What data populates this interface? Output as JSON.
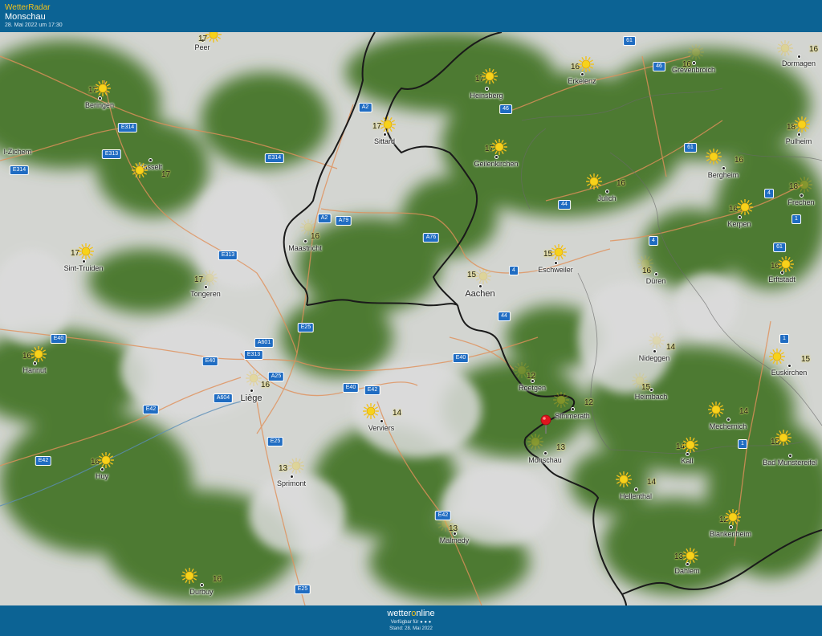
{
  "header": {
    "app_title": "WetterRadar",
    "location": "Monschau",
    "timestamp": "28. Mai 2022 um 17:30"
  },
  "footer": {
    "brand_pre": "wetter",
    "brand_o": "o",
    "brand_post": "nline",
    "availability": "Verfügbar für",
    "stand": "Stand: 28. Mai 2022"
  },
  "colors": {
    "header_bg": "#0c6394",
    "accent": "#f2c21b",
    "land_green": "#4f7a36",
    "cloud": "#d6d6d6",
    "roads": "#e0905a",
    "border": "#1a1a1a",
    "shield": "#1f6cc2"
  },
  "map": {
    "cities": [
      {
        "name": "Peer",
        "temp": "17"
      },
      {
        "name": "Beringen",
        "temp": "17"
      },
      {
        "name": "Heinsberg",
        "temp": "17"
      },
      {
        "name": "Erkelenz",
        "temp": "16"
      },
      {
        "name": "Grevenbroich",
        "temp": "16"
      },
      {
        "name": "Dormagen",
        "temp": "16"
      },
      {
        "name": "Sittard",
        "temp": "17"
      },
      {
        "name": "Pulheim",
        "temp": "18"
      },
      {
        "name": "Geilenkirchen",
        "temp": "17"
      },
      {
        "name": "Bergheim",
        "temp": "16"
      },
      {
        "name": "Hasselt",
        "temp": "17"
      },
      {
        "name": "Julich",
        "temp": "16"
      },
      {
        "name": "Frechen",
        "temp": "18"
      },
      {
        "name": "Kerpen",
        "temp": "16"
      },
      {
        "name": "Maastricht",
        "temp": "16"
      },
      {
        "name": "Sint-Truiden",
        "temp": "17"
      },
      {
        "name": "Eschweiler",
        "temp": "15"
      },
      {
        "name": "Erftstadt",
        "temp": "16"
      },
      {
        "name": "Düren",
        "temp": "16"
      },
      {
        "name": "Tongeren",
        "temp": "17"
      },
      {
        "name": "Aachen",
        "temp": "15"
      },
      {
        "name": "Nideggen",
        "temp": "14"
      },
      {
        "name": "Hannut",
        "temp": "16"
      },
      {
        "name": "Euskirchen",
        "temp": "15"
      },
      {
        "name": "Roetgen",
        "temp": "12"
      },
      {
        "name": "Liège",
        "temp": "16"
      },
      {
        "name": "Heimbach",
        "temp": "15"
      },
      {
        "name": "Simmerath",
        "temp": "12"
      },
      {
        "name": "Verviers",
        "temp": "14"
      },
      {
        "name": "Mechernich",
        "temp": "14"
      },
      {
        "name": "Monschau",
        "temp": "13"
      },
      {
        "name": "Kall",
        "temp": "14"
      },
      {
        "name": "Bad Munstereifel",
        "temp": "15"
      },
      {
        "name": "Huy",
        "temp": "16"
      },
      {
        "name": "Sprimont",
        "temp": "13"
      },
      {
        "name": "Hellenthal",
        "temp": "14"
      },
      {
        "name": "Blankenheim",
        "temp": "12"
      },
      {
        "name": "Malmedy",
        "temp": "13"
      },
      {
        "name": "Dahlem",
        "temp": "13"
      },
      {
        "name": "Durbuy",
        "temp": "16"
      }
    ],
    "edge_label": "l-Zichem",
    "roads": [
      "61",
      "46",
      "A2",
      "E314",
      "46",
      "E313",
      "E314",
      "61",
      "E314",
      "4",
      "44",
      "A2",
      "A79",
      "A76",
      "4",
      "E313",
      "61",
      "4",
      "1",
      "E25",
      "44",
      "E40",
      "A601",
      "E40",
      "E313",
      "E40",
      "1",
      "A25",
      "E40",
      "E42",
      "A604",
      "E42",
      "E25",
      "E42",
      "1",
      "E42",
      "E25"
    ]
  }
}
